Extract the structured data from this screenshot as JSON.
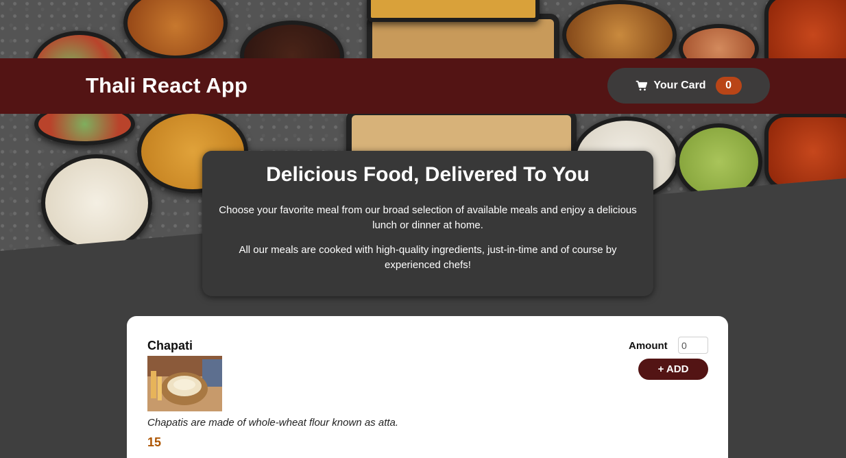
{
  "header": {
    "app_title": "Thali React App",
    "cart_label": "Your Card",
    "cart_count": "0",
    "cart_icon": "cart-icon"
  },
  "summary": {
    "title": "Delicious Food, Delivered To You",
    "paragraph1": "Choose your favorite meal from our broad selection of available meals and enjoy a delicious lunch or dinner at home.",
    "paragraph2": "All our meals are cooked with high-quality ingredients, just-in-time and of course by experienced chefs!"
  },
  "meals": [
    {
      "name": "Chapati",
      "description": "Chapatis are made of whole-wheat flour known as atta.",
      "price": "15",
      "amount_label": "Amount",
      "amount_value": "0",
      "add_label": "+ ADD"
    }
  ],
  "colors": {
    "header_bg": "#531414",
    "page_bg": "#3f3f3f",
    "badge_bg": "#b94517",
    "price_color": "#ad5502"
  }
}
